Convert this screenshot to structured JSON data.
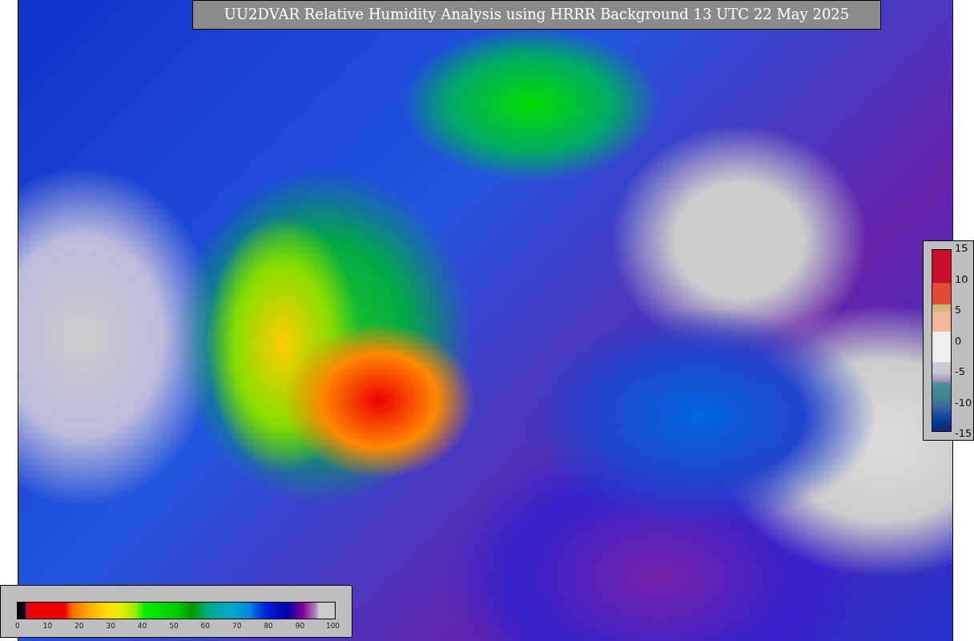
{
  "title": "UU2DVAR Relative Humidity Analysis using HRRR Background 13 UTC 22 May 2025",
  "humidity_colorbar": {
    "ticks": [
      "0",
      "10",
      "20",
      "30",
      "40",
      "50",
      "60",
      "70",
      "80",
      "90",
      "100"
    ]
  },
  "difference_colorbar": {
    "ticks": [
      "15",
      "10",
      "5",
      "0",
      "-5",
      "-10",
      "-15"
    ]
  }
}
